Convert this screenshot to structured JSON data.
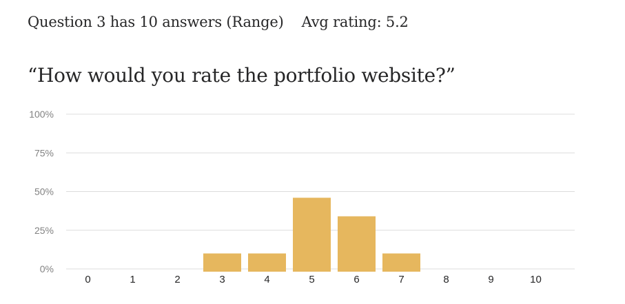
{
  "summary": {
    "answers_text": "Question 3 has 10 answers (Range)",
    "avg_text": "Avg rating: 5.2"
  },
  "question_text": "“How would you rate the portfolio website?”",
  "colors": {
    "bar": "#e6b75e",
    "grid": "#dcdcdc",
    "tick_y": "#828282",
    "tick_x": "#262627"
  },
  "chart_data": {
    "type": "bar",
    "title": "",
    "xlabel": "",
    "ylabel": "",
    "categories": [
      "0",
      "1",
      "2",
      "3",
      "4",
      "5",
      "6",
      "7",
      "8",
      "9",
      "10"
    ],
    "values": [
      0,
      0,
      0,
      10,
      10,
      46,
      34,
      10,
      0,
      0,
      0
    ],
    "ylim": [
      0,
      100
    ],
    "yticks": [
      "0%",
      "25%",
      "50%",
      "75%",
      "100%"
    ],
    "grid": true
  }
}
